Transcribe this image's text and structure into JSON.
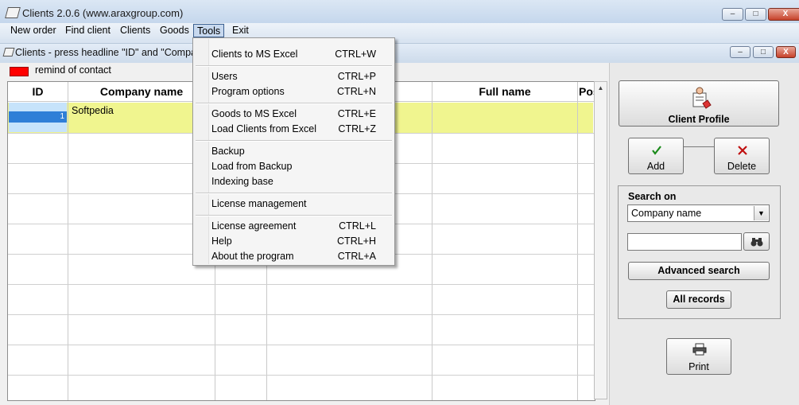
{
  "window": {
    "title": "Clients 2.0.6 (www.araxgroup.com)",
    "controls": {
      "minimize": "–",
      "maximize": "□",
      "close": "X"
    }
  },
  "menubar": {
    "items": [
      "New order",
      "Find client",
      "Clients",
      "Goods",
      "Tools",
      "Exit"
    ],
    "active": "Tools"
  },
  "inner_window": {
    "title": "Clients - press headline \"ID\" and \"Compan",
    "controls": {
      "minimize": "–",
      "maximize": "□",
      "close": "X"
    }
  },
  "legend": {
    "label": "remind of contact",
    "swatch_color": "#ff0000"
  },
  "grid": {
    "columns": [
      "ID",
      "Company name",
      "",
      "",
      "Full name",
      "Pos"
    ],
    "rows": [
      {
        "id": "1",
        "company": "Softpedia"
      }
    ],
    "highlight_color": "#f0f58f"
  },
  "dropdown": {
    "groups": [
      [
        {
          "label": "Clients to MS Excel",
          "shortcut": "CTRL+W"
        }
      ],
      [
        {
          "label": "Users",
          "shortcut": "CTRL+P"
        },
        {
          "label": "Program options",
          "shortcut": "CTRL+N"
        }
      ],
      [
        {
          "label": "Goods to MS Excel",
          "shortcut": "CTRL+E"
        },
        {
          "label": "Load Clients from Excel",
          "shortcut": "CTRL+Z"
        }
      ],
      [
        {
          "label": "Backup",
          "shortcut": ""
        },
        {
          "label": "Load from Backup",
          "shortcut": ""
        },
        {
          "label": "Indexing base",
          "shortcut": ""
        }
      ],
      [
        {
          "label": "License management",
          "shortcut": ""
        }
      ],
      [
        {
          "label": "License agreement",
          "shortcut": "CTRL+L"
        },
        {
          "label": "Help",
          "shortcut": "CTRL+H"
        },
        {
          "label": "About the program",
          "shortcut": "CTRL+A"
        }
      ]
    ]
  },
  "panel": {
    "client_profile": "Client Profile",
    "add": "Add",
    "delete": "Delete",
    "search_on_label": "Search on",
    "search_field": "Company name",
    "search_value": "",
    "advanced_search": "Advanced search",
    "all_records": "All records",
    "print": "Print"
  },
  "icons": {
    "app": "app-icon",
    "add": "checkmark-icon",
    "delete": "x-icon",
    "find": "binoculars-icon",
    "print": "printer-icon",
    "client_profile": "client-profile-icon",
    "colors": {
      "add": "#1a8a1a",
      "delete": "#c01010"
    }
  }
}
